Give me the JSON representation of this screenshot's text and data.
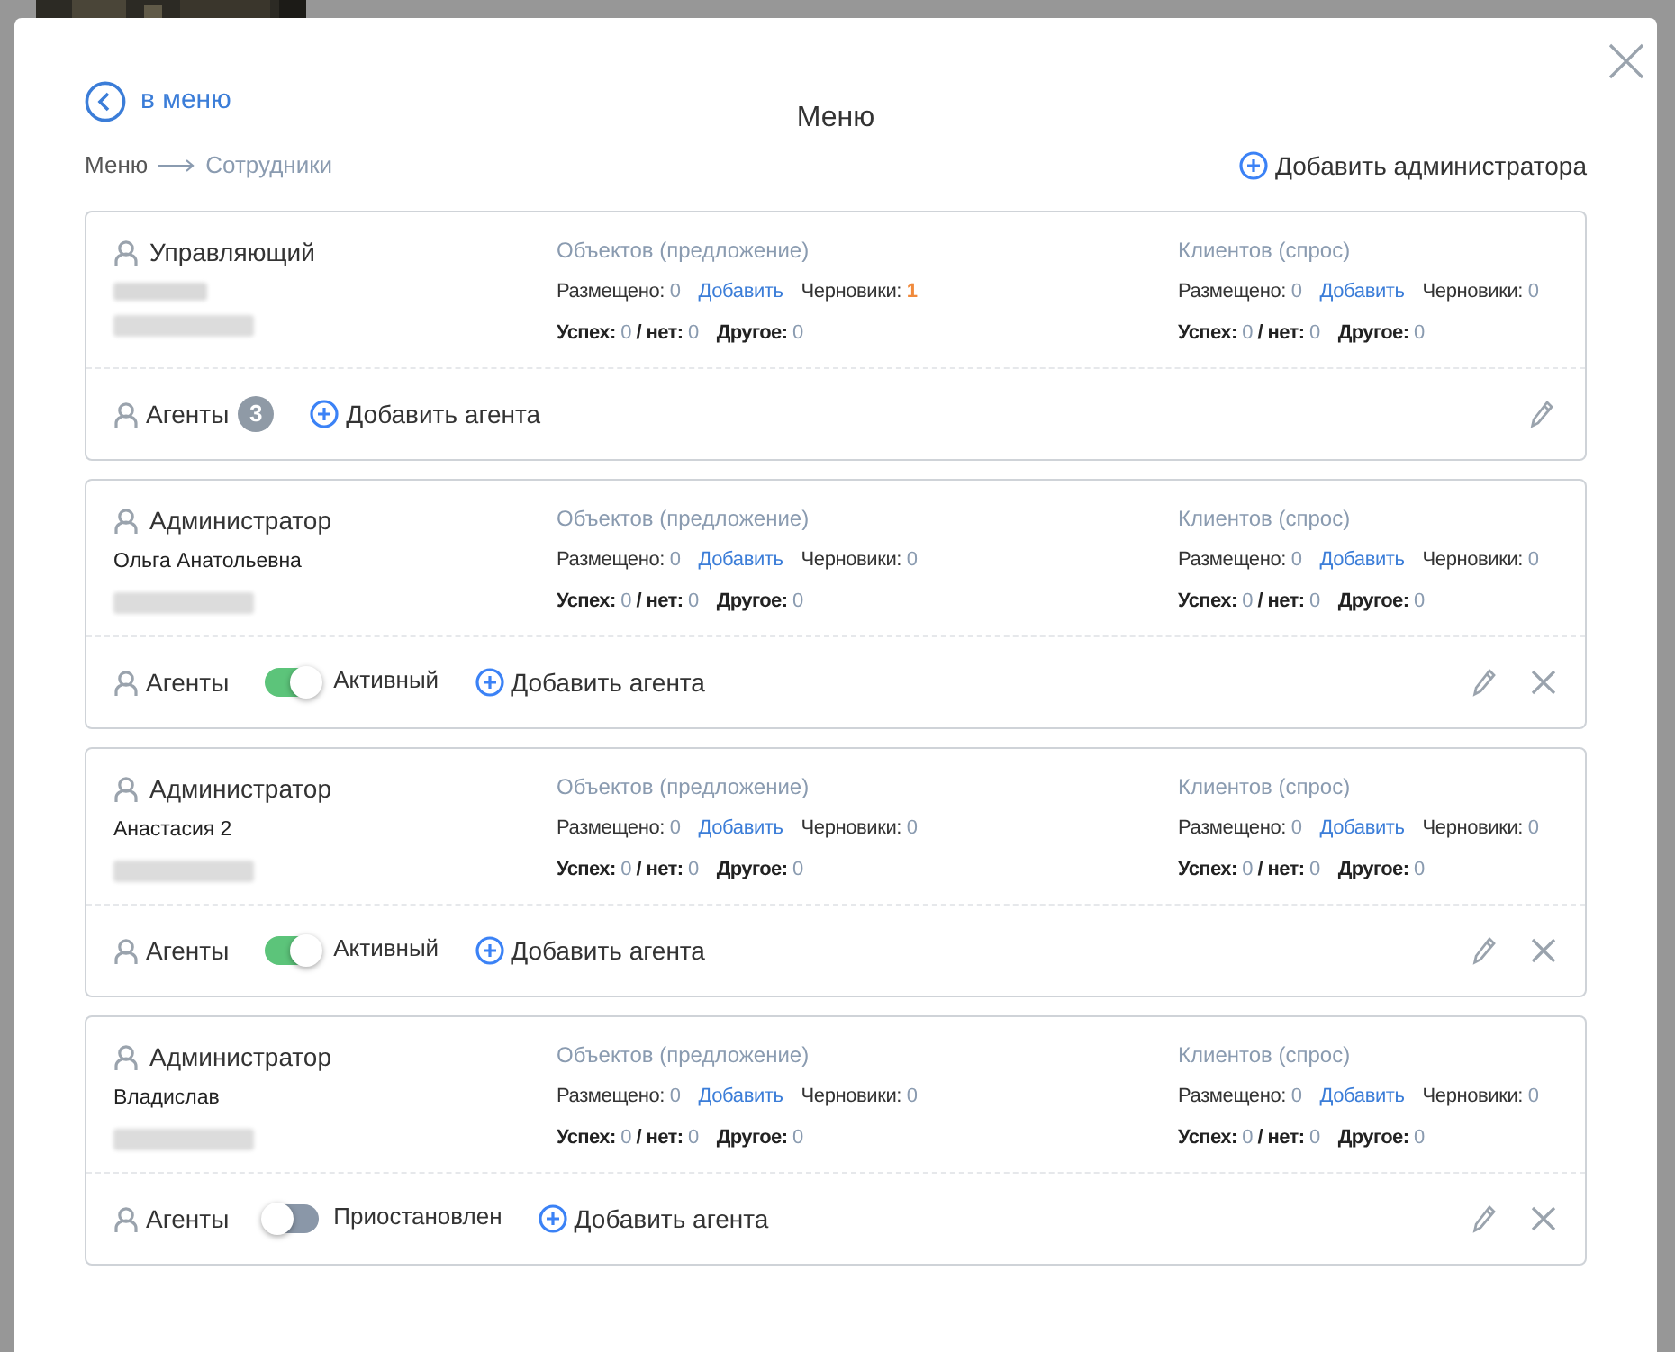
{
  "back_link": "в меню",
  "title": "Меню",
  "breadcrumb": [
    {
      "label": "Меню",
      "selected": false
    },
    {
      "label": "Сотрудники",
      "selected": true
    }
  ],
  "add_admin": "Добавить администратора",
  "cards": [
    {
      "role": "Управляющий",
      "name_redacted": true,
      "objects": {
        "heading": "Объектов (предложение)",
        "placed_label": "Размещено:",
        "placed": "0",
        "add": "Добавить",
        "drafts_label": "Черновики:",
        "drafts": "1",
        "drafts_highlight": true,
        "success_label": "Успех:",
        "success": "0",
        "no_label": "/ нет:",
        "no": "0",
        "other_label": "Другое:",
        "other": "0"
      },
      "clients": {
        "heading": "Клиентов (спрос)",
        "placed_label": "Размещено:",
        "placed": "0",
        "add": "Добавить",
        "drafts_label": "Черновики:",
        "drafts": "0",
        "drafts_highlight": false,
        "success_label": "Успех:",
        "success": "0",
        "no_label": "/ нет:",
        "no": "0",
        "other_label": "Другое:",
        "other": "0"
      },
      "agents_label": "Агенты",
      "agents_count": "3",
      "add_agent": "Добавить агента",
      "deletable": false
    },
    {
      "role": "Администратор",
      "name": "Ольга Анатольевна",
      "name_redacted": false,
      "objects": {
        "heading": "Объектов (предложение)",
        "placed_label": "Размещено:",
        "placed": "0",
        "add": "Добавить",
        "drafts_label": "Черновики:",
        "drafts": "0",
        "drafts_highlight": false,
        "success_label": "Успех:",
        "success": "0",
        "no_label": "/ нет:",
        "no": "0",
        "other_label": "Другое:",
        "other": "0"
      },
      "clients": {
        "heading": "Клиентов (спрос)",
        "placed_label": "Размещено:",
        "placed": "0",
        "add": "Добавить",
        "drafts_label": "Черновики:",
        "drafts": "0",
        "drafts_highlight": false,
        "success_label": "Успех:",
        "success": "0",
        "no_label": "/ нет:",
        "no": "0",
        "other_label": "Другое:",
        "other": "0"
      },
      "agents_label": "Агенты",
      "status": {
        "on": true,
        "label": "Активный"
      },
      "add_agent": "Добавить агента",
      "deletable": true
    },
    {
      "role": "Администратор",
      "name": "Анастасия 2",
      "name_redacted": false,
      "objects": {
        "heading": "Объектов (предложение)",
        "placed_label": "Размещено:",
        "placed": "0",
        "add": "Добавить",
        "drafts_label": "Черновики:",
        "drafts": "0",
        "drafts_highlight": false,
        "success_label": "Успех:",
        "success": "0",
        "no_label": "/ нет:",
        "no": "0",
        "other_label": "Другое:",
        "other": "0"
      },
      "clients": {
        "heading": "Клиентов (спрос)",
        "placed_label": "Размещено:",
        "placed": "0",
        "add": "Добавить",
        "drafts_label": "Черновики:",
        "drafts": "0",
        "drafts_highlight": false,
        "success_label": "Успех:",
        "success": "0",
        "no_label": "/ нет:",
        "no": "0",
        "other_label": "Другое:",
        "other": "0"
      },
      "agents_label": "Агенты",
      "status": {
        "on": true,
        "label": "Активный"
      },
      "add_agent": "Добавить агента",
      "deletable": true
    },
    {
      "role": "Администратор",
      "name": "Владислав",
      "name_redacted": false,
      "objects": {
        "heading": "Объектов (предложение)",
        "placed_label": "Размещено:",
        "placed": "0",
        "add": "Добавить",
        "drafts_label": "Черновики:",
        "drafts": "0",
        "drafts_highlight": false,
        "success_label": "Успех:",
        "success": "0",
        "no_label": "/ нет:",
        "no": "0",
        "other_label": "Другое:",
        "other": "0"
      },
      "clients": {
        "heading": "Клиентов (спрос)",
        "placed_label": "Размещено:",
        "placed": "0",
        "add": "Добавить",
        "drafts_label": "Черновики:",
        "drafts": "0",
        "drafts_highlight": false,
        "success_label": "Успех:",
        "success": "0",
        "no_label": "/ нет:",
        "no": "0",
        "other_label": "Другое:",
        "other": "0"
      },
      "agents_label": "Агенты",
      "status": {
        "on": false,
        "label": "Приостановлен"
      },
      "add_agent": "Добавить агента",
      "deletable": true
    }
  ]
}
